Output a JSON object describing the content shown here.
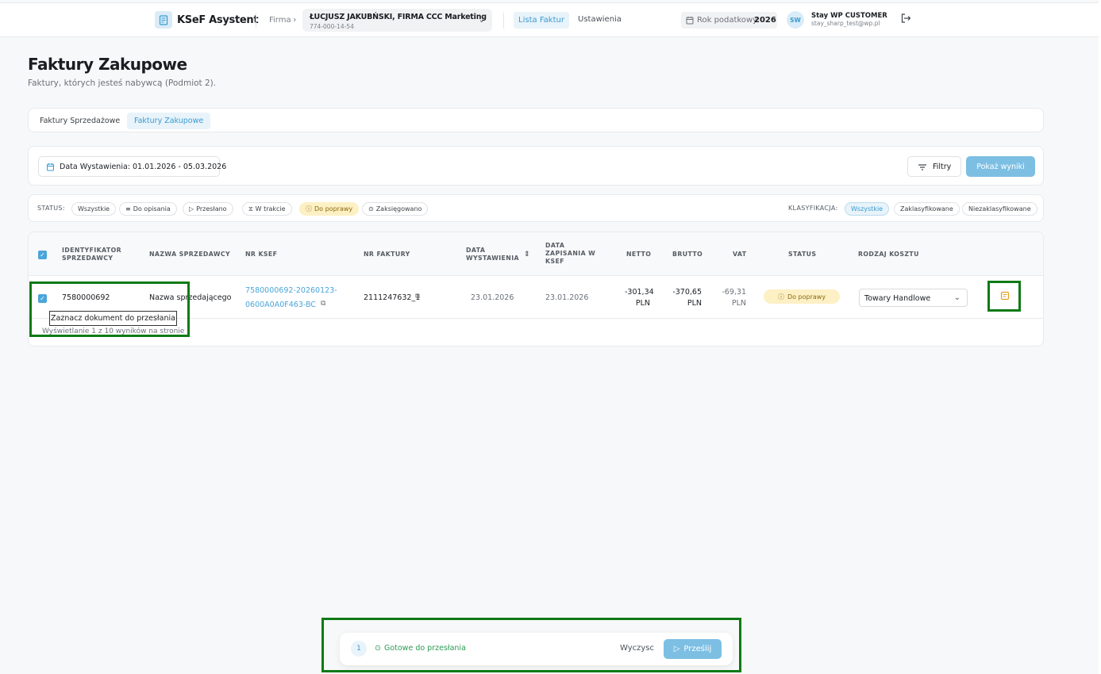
{
  "header": {
    "app_title": "KSeF Asystent",
    "firma_label": "Firma",
    "company_name": "ŁUCJUSZ JAKUBŃSKI, FIRMA CCC Marketing",
    "company_nip": "774-000-14-54",
    "nav": [
      {
        "label": "Lista Faktur"
      },
      {
        "label": "Ustawienia"
      }
    ],
    "tax_year_label": "Rok podatkowy",
    "tax_year_value": "2026",
    "user_initials": "SW",
    "user_name": "Stay WP CUSTOMER",
    "user_email": "stay_sharp_test@wp.pl"
  },
  "page": {
    "title": "Faktury Zakupowe",
    "subtitle": "Faktury, których jesteś nabywcą (Podmiot 2)."
  },
  "tabs": [
    {
      "label": "Faktury Sprzedażowe"
    },
    {
      "label": "Faktury Zakupowe"
    }
  ],
  "filters": {
    "date_range": "Data Wystawienia: 01.01.2026 - 05.03.2026",
    "filters_button": "Filtry",
    "show_results_button": "Pokaż wyniki"
  },
  "status_filter": {
    "label": "STATUS:",
    "chips": [
      {
        "label": "Wszystkie"
      },
      {
        "label": "Do opisania"
      },
      {
        "label": "Przesłano"
      },
      {
        "label": "W trakcie"
      },
      {
        "label": "Do poprawy"
      },
      {
        "label": "Zaksięgowano"
      }
    ]
  },
  "classification_filter": {
    "label": "KLASYFIKACJA:",
    "chips": [
      {
        "label": "Wszystkie"
      },
      {
        "label": "Zaklasyfikowane"
      },
      {
        "label": "Niezaklasyfikowane"
      }
    ]
  },
  "table": {
    "headers": {
      "seller_id_1": "IDENTYFIKATOR",
      "seller_id_2": "SPRZEDAWCY",
      "seller_name": "NAZWA SPRZEDAWCY",
      "ksef_nr": "NR KSEF",
      "invoice_nr": "NR FAKTURY",
      "issue_date_1": "DATA",
      "issue_date_2": "WYSTAWIENIA",
      "save_date_1": "DATA",
      "save_date_2": "ZAPISANIA W",
      "save_date_3": "KSEF",
      "net": "NETTO",
      "gross": "BRUTTO",
      "vat": "VAT",
      "status": "STATUS",
      "cost_type": "RODZAJ KOSZTU"
    },
    "rows": [
      {
        "seller_id": "7580000692",
        "seller_name": "Nazwa sprzedającego",
        "ksef_nr_1": "7580000692-20260123-",
        "ksef_nr_2": "0600A0A0F463-BC",
        "invoice_nr": "2111247632_1",
        "issue_date": "23.01.2026",
        "save_date": "23.01.2026",
        "net_value": "-301,34",
        "gross_value": "-370,65",
        "vat_value": "-69,31",
        "currency": "PLN",
        "status": "Do poprawy",
        "cost_type": "Towary Handlowe"
      }
    ],
    "tooltip": "Zaznacz dokument do przesłania",
    "results_text": "Wyświetlanie 1 z 10 wyników na stronie"
  },
  "bottom_bar": {
    "count": "1",
    "ready_label": "Gotowe do przesłania",
    "clear_button": "Wyczysc",
    "send_button": "Prześlij"
  },
  "colors": {
    "accent": "#4aa5d9",
    "warning_bg": "#fdf0c4",
    "success": "#2d9a55",
    "highlight": "#0d7a16"
  }
}
